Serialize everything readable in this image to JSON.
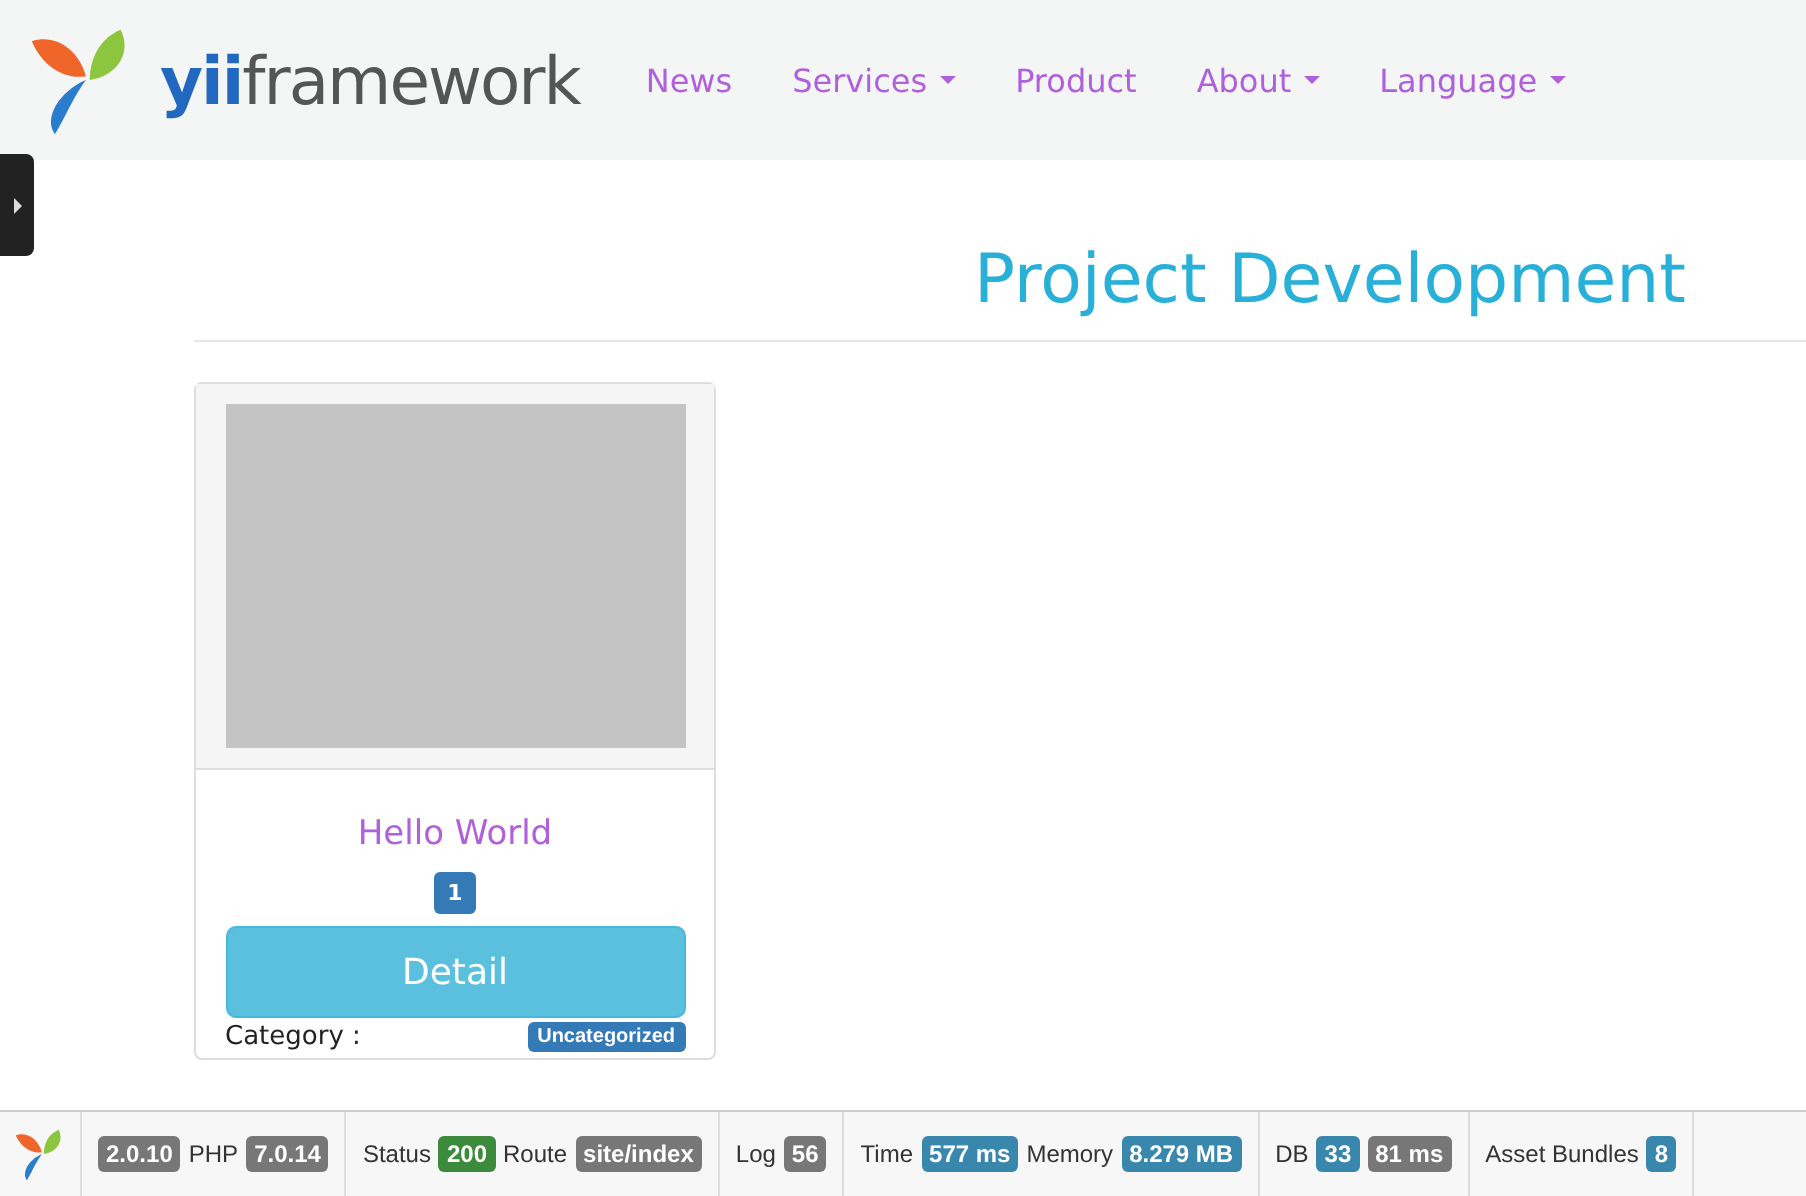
{
  "navbar": {
    "logo_prefix": "yii",
    "logo_rest": "framework",
    "items": [
      {
        "label": "News",
        "dropdown": false
      },
      {
        "label": "Services",
        "dropdown": true
      },
      {
        "label": "Product",
        "dropdown": false
      },
      {
        "label": "About",
        "dropdown": true
      },
      {
        "label": "Language",
        "dropdown": true
      }
    ]
  },
  "heading": "Project Development",
  "cards": [
    {
      "title": "Hello World",
      "count": "1",
      "button": "Detail",
      "category_label": "Category :",
      "category": "Uncategorized"
    }
  ],
  "debug_toolbar": {
    "blocks": [
      {
        "items": [
          {
            "kind": "badge",
            "text": "2.0.10",
            "color": "#777777"
          },
          {
            "kind": "label",
            "text": "PHP"
          },
          {
            "kind": "badge",
            "text": "7.0.14",
            "color": "#777777"
          }
        ]
      },
      {
        "items": [
          {
            "kind": "label",
            "text": "Status"
          },
          {
            "kind": "badge",
            "text": "200",
            "color": "#3c8a3c"
          },
          {
            "kind": "label",
            "text": "Route"
          },
          {
            "kind": "badge",
            "text": "site/index",
            "color": "#777777"
          }
        ]
      },
      {
        "items": [
          {
            "kind": "label",
            "text": "Log"
          },
          {
            "kind": "badge",
            "text": "56",
            "color": "#777777"
          }
        ]
      },
      {
        "items": [
          {
            "kind": "label",
            "text": "Time"
          },
          {
            "kind": "badge",
            "text": "577 ms",
            "color": "#3a87ad"
          },
          {
            "kind": "label",
            "text": "Memory"
          },
          {
            "kind": "badge",
            "text": "8.279 MB",
            "color": "#3a87ad"
          }
        ]
      },
      {
        "items": [
          {
            "kind": "label",
            "text": "DB"
          },
          {
            "kind": "badge",
            "text": "33",
            "color": "#3a87ad"
          },
          {
            "kind": "badge",
            "text": "81 ms",
            "color": "#777777"
          }
        ]
      },
      {
        "items": [
          {
            "kind": "label",
            "text": "Asset Bundles"
          },
          {
            "kind": "badge",
            "text": "8",
            "color": "#3a87ad"
          }
        ]
      }
    ]
  }
}
